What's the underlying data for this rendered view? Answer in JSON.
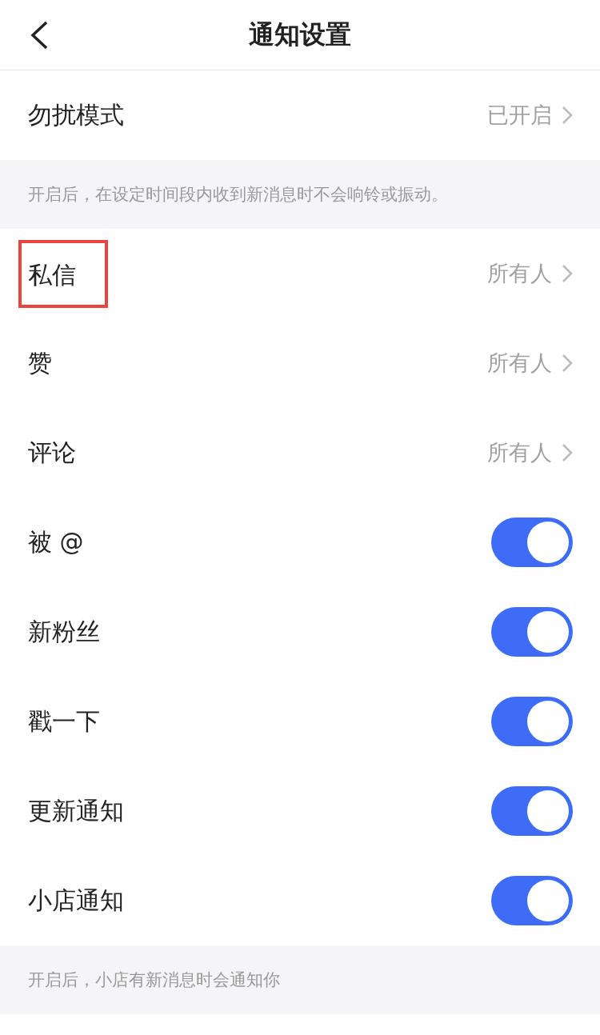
{
  "header": {
    "title": "通知设置"
  },
  "sections": [
    {
      "rows": [
        {
          "kind": "link",
          "label": "勿扰模式",
          "value": "已开启",
          "highlighted": false
        }
      ],
      "note": "开启后，在设定时间段内收到新消息时不会响铃或振动。"
    },
    {
      "rows": [
        {
          "kind": "link",
          "label": "私信",
          "value": "所有人",
          "highlighted": true
        },
        {
          "kind": "link",
          "label": "赞",
          "value": "所有人",
          "highlighted": false
        },
        {
          "kind": "link",
          "label": "评论",
          "value": "所有人",
          "highlighted": false
        },
        {
          "kind": "toggle",
          "label": "被 @",
          "on": true,
          "highlighted": false
        },
        {
          "kind": "toggle",
          "label": "新粉丝",
          "on": true,
          "highlighted": false
        },
        {
          "kind": "toggle",
          "label": "戳一下",
          "on": true,
          "highlighted": false
        },
        {
          "kind": "toggle",
          "label": "更新通知",
          "on": true,
          "highlighted": false
        },
        {
          "kind": "toggle",
          "label": "小店通知",
          "on": true,
          "highlighted": false
        }
      ],
      "note": "开启后，小店有新消息时会通知你"
    }
  ]
}
